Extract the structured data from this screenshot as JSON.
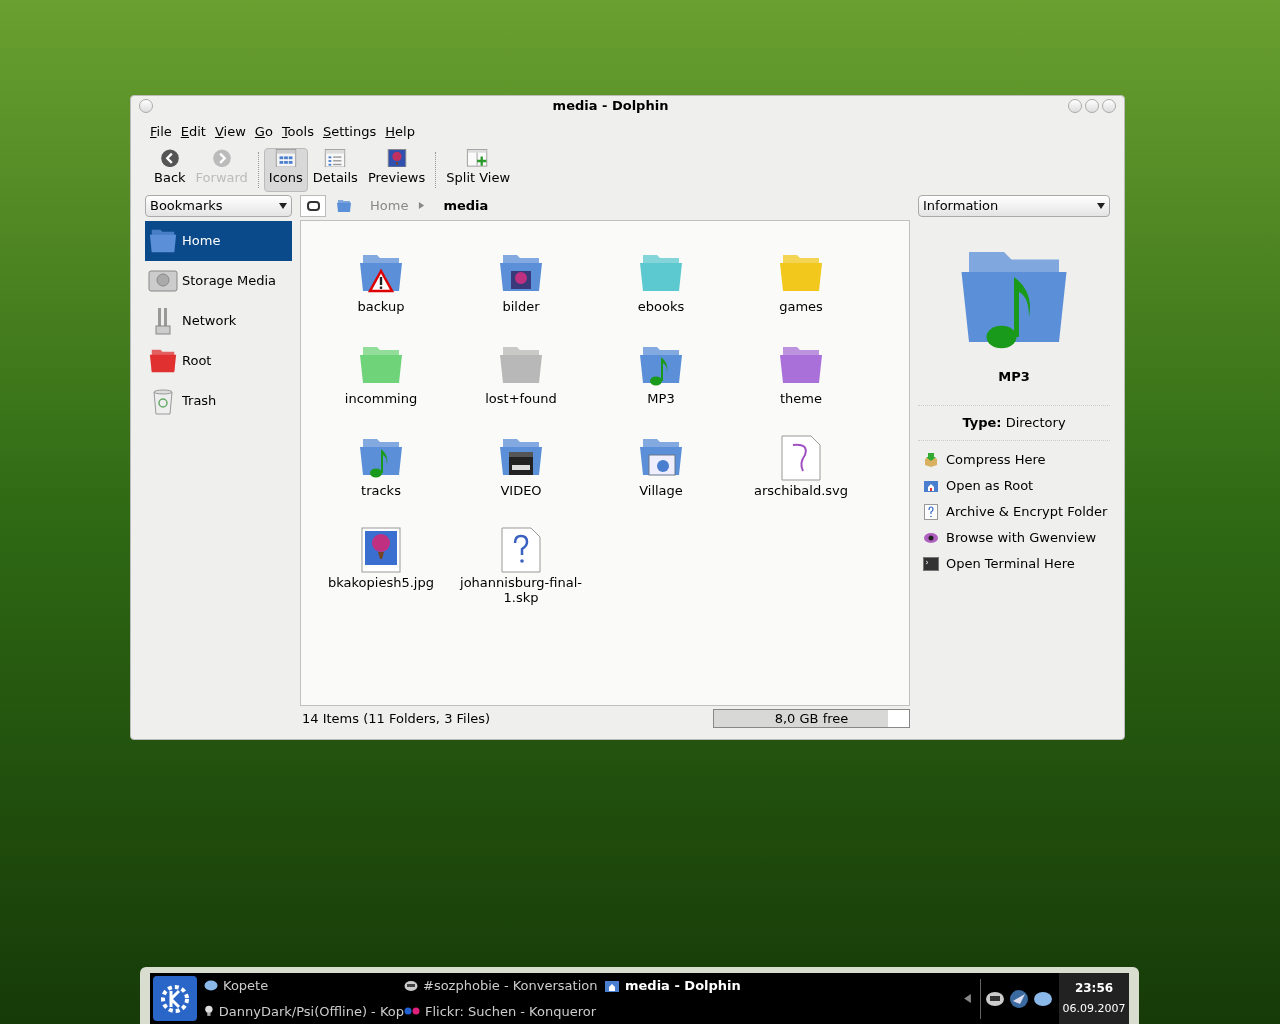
{
  "window": {
    "title": "media - Dolphin"
  },
  "menu": [
    "File",
    "Edit",
    "View",
    "Go",
    "Tools",
    "Settings",
    "Help"
  ],
  "toolbar": [
    {
      "label": "Back",
      "kind": "back",
      "disabled": false,
      "selected": false,
      "separator": false
    },
    {
      "label": "Forward",
      "kind": "forward",
      "disabled": true,
      "selected": false,
      "separator": false
    },
    {
      "label": "Icons",
      "kind": "icons",
      "disabled": false,
      "selected": true,
      "separator": true
    },
    {
      "label": "Details",
      "kind": "details",
      "disabled": false,
      "selected": false,
      "separator": false
    },
    {
      "label": "Previews",
      "kind": "previews",
      "disabled": false,
      "selected": false,
      "separator": false
    },
    {
      "label": "Split View",
      "kind": "split",
      "disabled": false,
      "selected": false,
      "separator": true
    }
  ],
  "places": {
    "dropdown": "Bookmarks",
    "items": [
      {
        "label": "Home",
        "kind": "home",
        "selected": true
      },
      {
        "label": "Storage Media",
        "kind": "disk",
        "selected": false
      },
      {
        "label": "Network",
        "kind": "network",
        "selected": false
      },
      {
        "label": "Root",
        "kind": "root",
        "selected": false
      },
      {
        "label": "Trash",
        "kind": "trash",
        "selected": false
      }
    ]
  },
  "breadcrumb": [
    "Home",
    "media"
  ],
  "files": [
    {
      "name": "backup",
      "kind": "warning",
      "color": "#5b8fd8"
    },
    {
      "name": "bilder",
      "kind": "photo",
      "color": "#5b8fd8"
    },
    {
      "name": "ebooks",
      "kind": "folder",
      "color": "#5cc8d0"
    },
    {
      "name": "games",
      "kind": "folder",
      "color": "#f2c81c"
    },
    {
      "name": "incomming",
      "kind": "folder",
      "color": "#6fd37a"
    },
    {
      "name": "lost+found",
      "kind": "folder",
      "color": "#b8b8b8"
    },
    {
      "name": "MP3",
      "kind": "note",
      "color": "#5b8fd8"
    },
    {
      "name": "theme",
      "kind": "folder",
      "color": "#a870d8"
    },
    {
      "name": "tracks",
      "kind": "note",
      "color": "#5b8fd8"
    },
    {
      "name": "VIDEO",
      "kind": "film",
      "color": "#5b8fd8"
    },
    {
      "name": "Village",
      "kind": "web",
      "color": "#5b8fd8"
    },
    {
      "name": "arschibald.svg",
      "kind": "svg"
    },
    {
      "name": "bkakopiesh5.jpg",
      "kind": "image"
    },
    {
      "name": "johannisburg-final-1.skp",
      "kind": "unknown"
    }
  ],
  "info": {
    "dropdown": "Information",
    "name": "MP3",
    "type": "**Type:** Directory",
    "actions": [
      {
        "label": "Compress Here",
        "kind": "compress"
      },
      {
        "label": "Open as Root",
        "kind": "root"
      },
      {
        "label": "Archive & Encrypt Folder",
        "kind": "unknown"
      },
      {
        "label": "Browse with Gwenview",
        "kind": "eye"
      },
      {
        "label": "Open Terminal Here",
        "kind": "terminal"
      }
    ]
  },
  "status": {
    "text": "14 Items (11 Folders, 3 Files)",
    "free": "8,0 GB free",
    "level": 0.89
  },
  "taskbar": {
    "tasks": [
      {
        "label": "Kopete",
        "kind": "chat",
        "selected": false
      },
      {
        "label": "DannyDark/Psi(Offline) - Kop",
        "kind": "bulb",
        "selected": false
      },
      {
        "label": "#sozphobie - Konversation",
        "kind": "irc",
        "selected": false
      },
      {
        "label": "Flickr: Suchen - Konqueror",
        "kind": "flickr",
        "selected": false
      },
      {
        "label": "media - Dolphin",
        "kind": "folder",
        "selected": true
      }
    ],
    "time": "23:56",
    "date": "06.09.2007"
  }
}
